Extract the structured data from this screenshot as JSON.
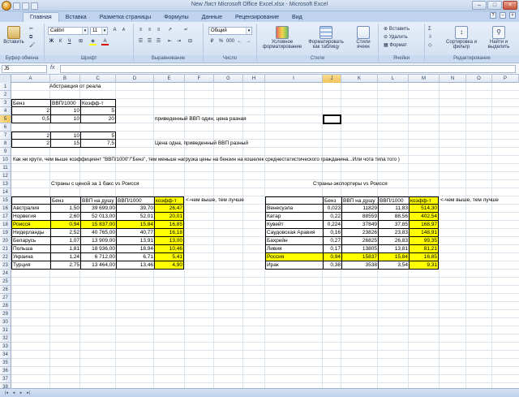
{
  "window": {
    "title": "New Лист Microsoft Office Excel.xlsx - Microsoft Excel"
  },
  "tabs": [
    "Главная",
    "Вставка",
    "Разметка страницы",
    "Формулы",
    "Данные",
    "Рецензирование",
    "Вид"
  ],
  "ribbon": {
    "paste_label": "Вставить",
    "clipboard_label": "Буфер обмена",
    "font_name": "Calibri",
    "font_size": "11",
    "font_label": "Шрифт",
    "align_label": "Выравнивание",
    "number_format": "Общий",
    "number_label": "Число",
    "cond_format_label": "Условное форматирование",
    "format_table_label": "Форматировать как таблицу",
    "cell_styles_label": "Стили ячеек",
    "styles_label": "Стили",
    "insert_label": "Вставить",
    "delete_label": "Удалить",
    "format_label": "Формат",
    "cells_label": "Ячейки",
    "sort_label": "Сортировка и фильтр",
    "find_label": "Найти и выделить",
    "editing_label": "Редактирование",
    "bold": "Ж",
    "italic": "К",
    "underline": "Ч"
  },
  "formula_bar": {
    "name_box": "J5",
    "fx": "fx",
    "content": ""
  },
  "columns": [
    "A",
    "B",
    "C",
    "D",
    "E",
    "F",
    "G",
    "H",
    "I",
    "J",
    "K",
    "L",
    "M",
    "N",
    "O",
    "P"
  ],
  "rows": [
    "1",
    "2",
    "3",
    "4",
    "5",
    "6",
    "7",
    "8",
    "9",
    "10",
    "11",
    "12",
    "13",
    "14",
    "15",
    "16",
    "17",
    "18",
    "19",
    "20",
    "21",
    "22",
    "23",
    "24",
    "25",
    "26",
    "27",
    "28",
    "29",
    "30",
    "31",
    "32",
    "33",
    "34",
    "35",
    "36",
    "37",
    "38"
  ],
  "sheet": {
    "b1": "Абстракция от реала",
    "hdr_a3": "Бенз",
    "hdr_b3": "ВВП/1000",
    "hdr_c3": "Коэфф-т",
    "r4": [
      "2",
      "10",
      "5"
    ],
    "r5": [
      "0,5",
      "10",
      "20"
    ],
    "note5": "приведенный ВВП один, цена разная",
    "r7": [
      "2",
      "10",
      "5"
    ],
    "r8": [
      "2",
      "15",
      "7,5"
    ],
    "note8": "Цена одна, приведенный ВВП разный",
    "note10": "Как ни крути, чем выше коэффициент \"ВВП/1000\"/\"Бенз\", тем меньше нагрузка цены на бензин на кошелек среднестатистического гражданина...Или чота типа того )",
    "left_title": "Страны с ценой за 1 бакс vs Роисся",
    "right_title": "Страны-экспортеры vs Роисся",
    "left_headers": [
      "Бенз",
      "ВВП на душу",
      "ВВП/1000",
      "коэфф-т"
    ],
    "right_headers": [
      "Бенз",
      "ВВП на душу",
      "ВВП/1000",
      "коэфф-т"
    ],
    "note_higher": "<-чем выше, тем лучше",
    "left_rows": [
      {
        "country": "Австралия",
        "benz": "1,50",
        "gdp": "39 699,00",
        "gdp1000": "39,70",
        "coef": "26,47",
        "hl": false
      },
      {
        "country": "Норвегия",
        "benz": "2,60",
        "gdp": "52 013,00",
        "gdp1000": "52,01",
        "coef": "20,01",
        "hl": false
      },
      {
        "country": "Роисся",
        "benz": "0,94",
        "gdp": "15 837,00",
        "gdp1000": "15,84",
        "coef": "16,85",
        "hl": true
      },
      {
        "country": "Нидерланды",
        "benz": "2,52",
        "gdp": "40 765,00",
        "gdp1000": "40,77",
        "coef": "16,18",
        "hl": false
      },
      {
        "country": "Беларусь",
        "benz": "1,07",
        "gdp": "13 909,00",
        "gdp1000": "13,91",
        "coef": "13,00",
        "hl": false
      },
      {
        "country": "Польша",
        "benz": "1,81",
        "gdp": "18 936,00",
        "gdp1000": "18,94",
        "coef": "10,46",
        "hl": false
      },
      {
        "country": "Украина",
        "benz": "1,24",
        "gdp": "6 712,00",
        "gdp1000": "6,71",
        "coef": "5,41",
        "hl": false
      },
      {
        "country": "Турция",
        "benz": "2,75",
        "gdp": "13 464,00",
        "gdp1000": "13,46",
        "coef": "4,90",
        "hl": false
      }
    ],
    "right_rows": [
      {
        "country": "Венесуэла",
        "benz": "0,023",
        "gdp": "11829",
        "gdp1000": "11,83",
        "coef": "514,30",
        "hl": false
      },
      {
        "country": "Катар",
        "benz": "0,22",
        "gdp": "88559",
        "gdp1000": "88,56",
        "coef": "402,54",
        "hl": false
      },
      {
        "country": "Кувейт",
        "benz": "0,224",
        "gdp": "37849",
        "gdp1000": "37,85",
        "coef": "168,97",
        "hl": false
      },
      {
        "country": "Саудовская Аравия",
        "benz": "0,16",
        "gdp": "23826",
        "gdp1000": "23,83",
        "coef": "148,91",
        "hl": false
      },
      {
        "country": "Бахрейн",
        "benz": "0,27",
        "gdp": "26825",
        "gdp1000": "26,83",
        "coef": "99,35",
        "hl": false
      },
      {
        "country": "Ливия",
        "benz": "0,17",
        "gdp": "13805",
        "gdp1000": "13,81",
        "coef": "81,21",
        "hl": false
      },
      {
        "country": "Россия",
        "benz": "0,94",
        "gdp": "15837",
        "gdp1000": "15,84",
        "coef": "16,85",
        "hl": true
      },
      {
        "country": "Ирак",
        "benz": "0,38",
        "gdp": "3538",
        "gdp1000": "3,54",
        "coef": "9,31",
        "hl": false
      }
    ]
  },
  "colors": {
    "highlight": "#ffff00",
    "selected_header": "#f1c45a",
    "ribbon": "#d1dff1"
  }
}
